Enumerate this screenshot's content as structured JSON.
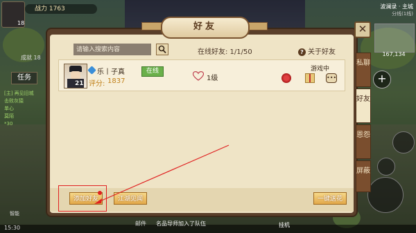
{
  "hud": {
    "power": "战力 1763",
    "player_level": "18",
    "chengjiu": "成就 18",
    "task_label": "任务",
    "quest_lines": [
      "[主] 再见旧城",
      "击败灰猿",
      "单心",
      "莫陌",
      "*30"
    ],
    "server_name": "波澜录 · 主城",
    "server_sub": "分线(1线)",
    "coords": "167,134",
    "plus": "+",
    "time": "15:30",
    "joystick_label": "智能",
    "chat_tag": "邮件",
    "chat_line": "名品导师加入了队伍",
    "guaji": "挂机"
  },
  "panel": {
    "title": "好友",
    "close": "✕",
    "search_placeholder": "请输入搜索内容",
    "online_count": "在线好友: 1/1/50",
    "about": "关于好友",
    "help_glyph": "?"
  },
  "friends": [
    {
      "name": "乐丨子真",
      "level": "21",
      "status_badge": "在线",
      "score_label": "评分:",
      "score": "1837",
      "intimacy": "1级",
      "activity": "游戏中"
    }
  ],
  "tabs": [
    {
      "label": "私聊",
      "active": false
    },
    {
      "label": "好友",
      "active": true
    },
    {
      "label": "恩怨",
      "active": false
    },
    {
      "label": "屏蔽",
      "active": false
    }
  ],
  "buttons": {
    "add_friend": "添加好友",
    "jianghu": "江湖见闻",
    "send_flowers": "一键送花"
  },
  "colors": {
    "panel_bg": "#efe4c6",
    "panel_border": "#5a3f2a",
    "online_green": "#6ab04a",
    "score_orange": "#c0801a",
    "annotation_red": "#e02020",
    "gold_button": "#e2a84a"
  }
}
